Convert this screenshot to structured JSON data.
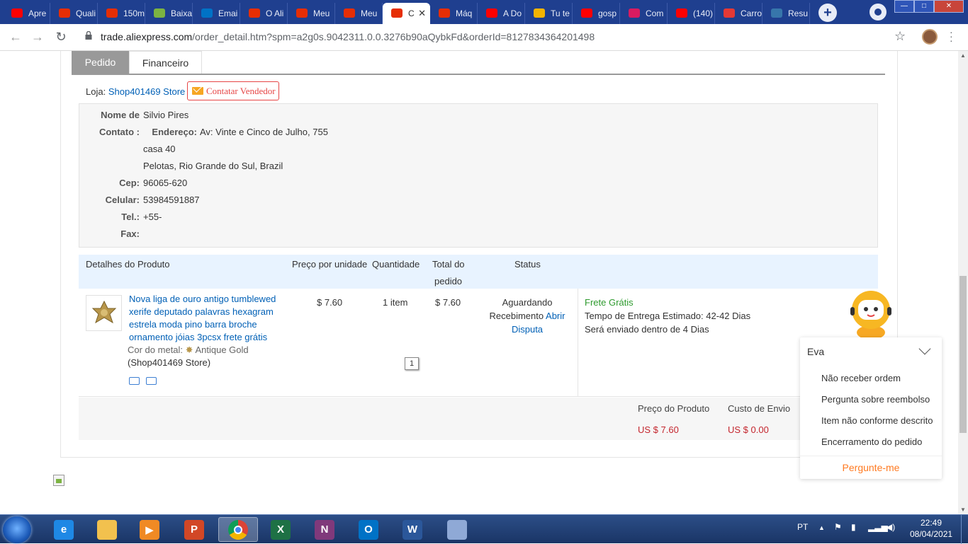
{
  "browser": {
    "tabs": [
      {
        "label": "Apre",
        "fav": "youtube-icon",
        "color": "#ff0000"
      },
      {
        "label": "Quali",
        "fav": "aliexpress-icon",
        "color": "#e62e04"
      },
      {
        "label": "150m",
        "fav": "aliexpress-icon",
        "color": "#e62e04"
      },
      {
        "label": "Baixa",
        "fav": "download-icon",
        "color": "#7cb342"
      },
      {
        "label": "Emai",
        "fav": "outlook-icon",
        "color": "#0072c6"
      },
      {
        "label": "O Ali",
        "fav": "aliexpress-icon",
        "color": "#e62e04"
      },
      {
        "label": "Meu",
        "fav": "aliexpress-icon",
        "color": "#e62e04"
      },
      {
        "label": "Meu",
        "fav": "aliexpress-icon",
        "color": "#e62e04"
      },
      {
        "label": "C",
        "fav": "aliexpress-icon",
        "color": "#e62e04",
        "active": true
      },
      {
        "label": "Máq",
        "fav": "aliexpress-icon",
        "color": "#e62e04"
      },
      {
        "label": "A Do",
        "fav": "youtube-icon",
        "color": "#ff0000"
      },
      {
        "label": "Tu te",
        "fav": "slides-icon",
        "color": "#f4b400"
      },
      {
        "label": "gosp",
        "fav": "youtube-icon",
        "color": "#ff0000"
      },
      {
        "label": "Com",
        "fav": "mio-icon",
        "color": "#d81b60"
      },
      {
        "label": "(140)",
        "fav": "youtube-icon",
        "color": "#ff0000"
      },
      {
        "label": "Carro",
        "fav": "acrobat-icon",
        "color": "#e53935"
      },
      {
        "label": "Resu",
        "fav": "python-icon",
        "color": "#3776ab"
      }
    ],
    "url_host": "trade.aliexpress.com",
    "url_rest": "/order_detail.htm?spm=a2g0s.9042311.0.0.3276b90aQybkFd&orderId=8127834364201498"
  },
  "order": {
    "tabs": [
      "Pedido",
      "Financeiro"
    ],
    "store_label": "Loja:",
    "store_name": "Shop401469 Store",
    "contact_seller": "Contatar Vendedor",
    "address": {
      "name_label": "Nome de",
      "name_value": "Silvio Pires",
      "contact_label": "Contato :",
      "street_label": "Endereço:",
      "street_value": "Av: Vinte e Cinco de Julho, 755",
      "line2": "casa 40",
      "line3": "Pelotas, Rio Grande do Sul, Brazil",
      "cep_label": "Cep:",
      "cep_value": "96065-620",
      "cel_label": "Celular:",
      "cel_value": "53984591887",
      "tel_label": "Tel.:",
      "tel_value": "+55-",
      "fax_label": "Fax:",
      "fax_value": ""
    },
    "headers": {
      "details": "Detalhes do Produto",
      "unit_price": "Preço por unidade",
      "quantity": "Quantidade",
      "total_line1": "Total do",
      "total_line2": "pedido",
      "status": "Status"
    },
    "product": {
      "title": "Nova liga de ouro antigo tumblewed xerife deputado palavras hexagram estrela moda pino barra broche ornamento jóias 3pcsx frete grátis",
      "metal_label": "Cor do metal:",
      "metal_value": "Antique Gold",
      "store": "(Shop401469 Store)",
      "unit_price": "$ 7.60",
      "quantity": "1 item",
      "total": "$ 7.60",
      "status_line1": "Aguardando",
      "status_line2": "Recebimento",
      "open_dispute_1": "Abrir",
      "open_dispute_2": "Disputa",
      "shipping": "Frete Grátis",
      "delivery_label": "Tempo de Entrega Estimado:",
      "delivery_value": "42-42 Dias",
      "ships_label": "Será enviado dentro de",
      "ships_value": "4 Dias",
      "page_badge": "1"
    },
    "summary": {
      "product_price_label": "Preço do Produto",
      "shipping_cost_label": "Custo de Envio",
      "product_price": "US $ 7.60",
      "shipping_cost": "US $ 0.00"
    }
  },
  "chat": {
    "name": "Eva",
    "options": [
      "Não receber ordem",
      "Pergunta sobre reembolso",
      "Item não conforme descrito",
      "Encerramento do pedido"
    ],
    "ask": "Pergunte-me"
  },
  "taskbar": {
    "apps": [
      {
        "name": "ie-icon",
        "label": "e",
        "color": "#1e88e5"
      },
      {
        "name": "explorer-icon",
        "label": "",
        "color": "#f2c14e"
      },
      {
        "name": "media-player-icon",
        "label": "▶",
        "color": "#f08a24"
      },
      {
        "name": "powerpoint-icon",
        "label": "P",
        "color": "#d24726"
      },
      {
        "name": "chrome-icon",
        "label": "",
        "color": "#4285f4",
        "active": true
      },
      {
        "name": "excel-icon",
        "label": "X",
        "color": "#1e7145"
      },
      {
        "name": "onenote-icon",
        "label": "N",
        "color": "#80397b"
      },
      {
        "name": "outlook-icon",
        "label": "O",
        "color": "#0072c6"
      },
      {
        "name": "word-icon",
        "label": "W",
        "color": "#2b579a"
      },
      {
        "name": "paint-icon",
        "label": "",
        "color": "#8fa9d6"
      }
    ],
    "lang": "PT",
    "time": "22:49",
    "date": "08/04/2021"
  }
}
